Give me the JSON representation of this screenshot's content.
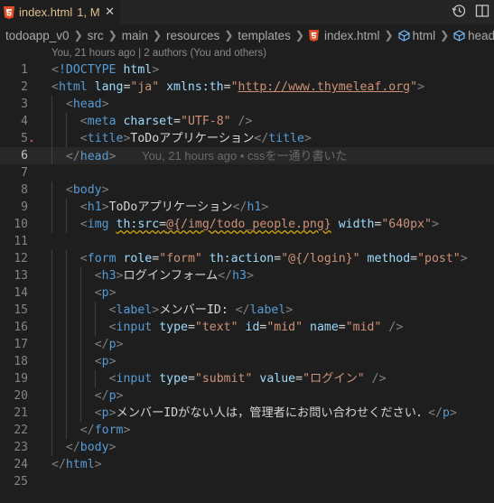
{
  "tab": {
    "title": "index.html",
    "badge": "1, M",
    "close": "✕"
  },
  "breadcrumb": [
    "todoapp_v0",
    "src",
    "main",
    "resources",
    "templates",
    "index.html",
    "html",
    "head"
  ],
  "blame_header": "You, 21 hours ago | 2 authors (You and others)",
  "inline_blame": "You, 21 hours ago • cssを一通り書いた",
  "lines": [
    {
      "n": "1",
      "segs": [
        [
          "br",
          "<"
        ],
        [
          "tag",
          "!DOCTYPE"
        ],
        [
          "txt",
          " "
        ],
        [
          "attr",
          "html"
        ],
        [
          "br",
          ">"
        ]
      ]
    },
    {
      "n": "2",
      "segs": [
        [
          "br",
          "<"
        ],
        [
          "tag",
          "html"
        ],
        [
          "txt",
          " "
        ],
        [
          "attr",
          "lang"
        ],
        [
          "txt",
          "="
        ],
        [
          "str",
          "\"ja\""
        ],
        [
          "txt",
          " "
        ],
        [
          "attr",
          "xmlns:th"
        ],
        [
          "txt",
          "="
        ],
        [
          "str",
          "\""
        ],
        [
          "link",
          "http://www.thymeleaf.org"
        ],
        [
          "str",
          "\""
        ],
        [
          "br",
          ">"
        ]
      ]
    },
    {
      "n": "3",
      "segs": [
        [
          "br",
          "<"
        ],
        [
          "tag",
          "head"
        ],
        [
          "br",
          ">"
        ]
      ]
    },
    {
      "n": "4",
      "segs": [
        [
          "br",
          "<"
        ],
        [
          "tag",
          "meta"
        ],
        [
          "txt",
          " "
        ],
        [
          "attr",
          "charset"
        ],
        [
          "txt",
          "="
        ],
        [
          "str",
          "\"UTF-8\""
        ],
        [
          "txt",
          " "
        ],
        [
          "br",
          "/>"
        ]
      ]
    },
    {
      "n": "5",
      "segs": [
        [
          "br",
          "<"
        ],
        [
          "tag",
          "title"
        ],
        [
          "br",
          ">"
        ],
        [
          "txt",
          "ToDoアプリケーション"
        ],
        [
          "br",
          "</"
        ],
        [
          "tag",
          "title"
        ],
        [
          "br",
          ">"
        ]
      ]
    },
    {
      "n": "6",
      "segs": [
        [
          "br",
          "</"
        ],
        [
          "tag",
          "head"
        ],
        [
          "br",
          ">"
        ]
      ]
    },
    {
      "n": "7",
      "segs": []
    },
    {
      "n": "8",
      "segs": [
        [
          "br",
          "<"
        ],
        [
          "tag",
          "body"
        ],
        [
          "br",
          ">"
        ]
      ]
    },
    {
      "n": "9",
      "segs": [
        [
          "br",
          "<"
        ],
        [
          "tag",
          "h1"
        ],
        [
          "br",
          ">"
        ],
        [
          "txt",
          "ToDoアプリケーション"
        ],
        [
          "br",
          "</"
        ],
        [
          "tag",
          "h1"
        ],
        [
          "br",
          ">"
        ]
      ]
    },
    {
      "n": "10",
      "segs": [
        [
          "br",
          "<"
        ],
        [
          "tag",
          "img"
        ],
        [
          "txt",
          " "
        ],
        [
          "attrw",
          "th:src"
        ],
        [
          "txtw",
          "="
        ],
        [
          "strw",
          "@{/img/todo_people.png}"
        ],
        [
          "txt",
          " "
        ],
        [
          "attr",
          "width"
        ],
        [
          "txt",
          "="
        ],
        [
          "str",
          "\"640px\""
        ],
        [
          "br",
          ">"
        ]
      ]
    },
    {
      "n": "11",
      "segs": []
    },
    {
      "n": "12",
      "segs": [
        [
          "br",
          "<"
        ],
        [
          "tag",
          "form"
        ],
        [
          "txt",
          " "
        ],
        [
          "attr",
          "role"
        ],
        [
          "txt",
          "="
        ],
        [
          "str",
          "\"form\""
        ],
        [
          "txt",
          " "
        ],
        [
          "attr",
          "th:action"
        ],
        [
          "txt",
          "="
        ],
        [
          "str",
          "\"@{/login}\""
        ],
        [
          "txt",
          " "
        ],
        [
          "attr",
          "method"
        ],
        [
          "txt",
          "="
        ],
        [
          "str",
          "\"post\""
        ],
        [
          "br",
          ">"
        ]
      ]
    },
    {
      "n": "13",
      "segs": [
        [
          "br",
          "<"
        ],
        [
          "tag",
          "h3"
        ],
        [
          "br",
          ">"
        ],
        [
          "txt",
          "ログインフォーム"
        ],
        [
          "br",
          "</"
        ],
        [
          "tag",
          "h3"
        ],
        [
          "br",
          ">"
        ]
      ]
    },
    {
      "n": "14",
      "segs": [
        [
          "br",
          "<"
        ],
        [
          "tag",
          "p"
        ],
        [
          "br",
          ">"
        ]
      ]
    },
    {
      "n": "15",
      "segs": [
        [
          "br",
          "<"
        ],
        [
          "tag",
          "label"
        ],
        [
          "br",
          ">"
        ],
        [
          "txt",
          "メンバーID: "
        ],
        [
          "br",
          "</"
        ],
        [
          "tag",
          "label"
        ],
        [
          "br",
          ">"
        ]
      ]
    },
    {
      "n": "16",
      "segs": [
        [
          "br",
          "<"
        ],
        [
          "tag",
          "input"
        ],
        [
          "txt",
          " "
        ],
        [
          "attr",
          "type"
        ],
        [
          "txt",
          "="
        ],
        [
          "str",
          "\"text\""
        ],
        [
          "txt",
          " "
        ],
        [
          "attr",
          "id"
        ],
        [
          "txt",
          "="
        ],
        [
          "str",
          "\"mid\""
        ],
        [
          "txt",
          " "
        ],
        [
          "attr",
          "name"
        ],
        [
          "txt",
          "="
        ],
        [
          "str",
          "\"mid\""
        ],
        [
          "txt",
          " "
        ],
        [
          "br",
          "/>"
        ]
      ]
    },
    {
      "n": "17",
      "segs": [
        [
          "br",
          "</"
        ],
        [
          "tag",
          "p"
        ],
        [
          "br",
          ">"
        ]
      ]
    },
    {
      "n": "18",
      "segs": [
        [
          "br",
          "<"
        ],
        [
          "tag",
          "p"
        ],
        [
          "br",
          ">"
        ]
      ]
    },
    {
      "n": "19",
      "segs": [
        [
          "br",
          "<"
        ],
        [
          "tag",
          "input"
        ],
        [
          "txt",
          " "
        ],
        [
          "attr",
          "type"
        ],
        [
          "txt",
          "="
        ],
        [
          "str",
          "\"submit\""
        ],
        [
          "txt",
          " "
        ],
        [
          "attr",
          "value"
        ],
        [
          "txt",
          "="
        ],
        [
          "str",
          "\"ログイン\""
        ],
        [
          "txt",
          " "
        ],
        [
          "br",
          "/>"
        ]
      ]
    },
    {
      "n": "20",
      "segs": [
        [
          "br",
          "</"
        ],
        [
          "tag",
          "p"
        ],
        [
          "br",
          ">"
        ]
      ]
    },
    {
      "n": "21",
      "segs": [
        [
          "br",
          "<"
        ],
        [
          "tag",
          "p"
        ],
        [
          "br",
          ">"
        ],
        [
          "txt",
          "メンバーIDがない人は，管理者にお問い合わせください．"
        ],
        [
          "br",
          "</"
        ],
        [
          "tag",
          "p"
        ],
        [
          "br",
          ">"
        ]
      ]
    },
    {
      "n": "22",
      "segs": [
        [
          "br",
          "</"
        ],
        [
          "tag",
          "form"
        ],
        [
          "br",
          ">"
        ]
      ]
    },
    {
      "n": "23",
      "segs": [
        [
          "br",
          "</"
        ],
        [
          "tag",
          "body"
        ],
        [
          "br",
          ">"
        ]
      ]
    },
    {
      "n": "24",
      "segs": [
        [
          "br",
          "</"
        ],
        [
          "tag",
          "html"
        ],
        [
          "br",
          ">"
        ]
      ]
    },
    {
      "n": "25",
      "segs": []
    }
  ]
}
